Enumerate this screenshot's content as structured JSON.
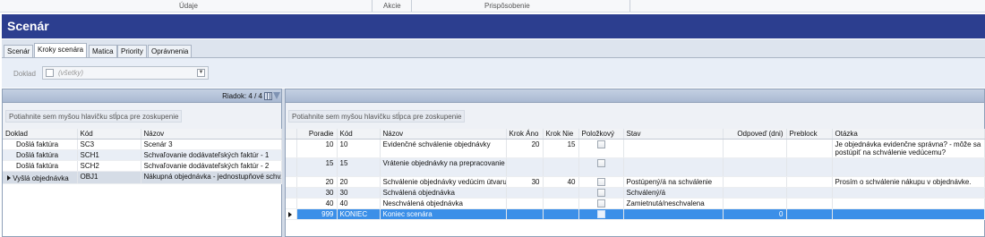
{
  "ribbon": {
    "groups": [
      "Údaje",
      "Akcie",
      "Prispôsobenie"
    ]
  },
  "window": {
    "title": "Scenár"
  },
  "tabs": [
    "Scenár",
    "Kroky scenára",
    "Matica",
    "Priority",
    "Oprávnenia"
  ],
  "active_tab": "Kroky scenára",
  "filter": {
    "label": "Doklad",
    "value": "(všetky)"
  },
  "left": {
    "rows_info": "Riadok: 4 / 4",
    "group_hint": "Potiahnite sem myšou hlavičku stĺpca pre zoskupenie",
    "columns": [
      "Doklad",
      "Kód",
      "Názov"
    ],
    "rows": [
      [
        "Došlá faktúra",
        "SC3",
        "Scenár 3"
      ],
      [
        "Došlá faktúra",
        "SCH1",
        "Schvaľovanie dodávateľských faktúr - 1"
      ],
      [
        "Došlá faktúra",
        "SCH2",
        "Schvaľovanie dodávateľských faktúr - 2"
      ],
      [
        "Vyšlá objednávka",
        "OBJ1",
        "Nákupná objednávka - jednostupňové schv."
      ]
    ]
  },
  "right": {
    "group_hint": "Potiahnite sem myšou hlavičku stĺpca pre zoskupenie",
    "columns": [
      "Poradie",
      "Kód",
      "Názov",
      "Krok Áno",
      "Krok Nie",
      "Položkový",
      "Stav",
      "Odpoveď (dni)",
      "Preblock",
      "Otázka"
    ],
    "rows": [
      [
        "10",
        "10",
        "Evidenčné schválenie objednávky",
        "20",
        "15",
        "",
        "",
        "",
        "",
        "Je objednávka evidenčne správna? - môže sa postúpiť na schválenie vedúcemu?"
      ],
      [
        "15",
        "15",
        "Vrátenie objednávky na prepracovanie",
        "",
        "",
        "",
        "",
        "",
        "",
        ""
      ],
      [
        "20",
        "20",
        "Schválenie objednávky vedúcim útvaru",
        "30",
        "40",
        "",
        "Postúpený/á na schválenie",
        "",
        "",
        "Prosím o schválenie nákupu v objednávke."
      ],
      [
        "30",
        "30",
        "Schválená objednávka",
        "",
        "",
        "",
        "Schválený/á",
        "",
        "",
        ""
      ],
      [
        "40",
        "40",
        "Neschválená objednávka",
        "",
        "",
        "",
        "Zamietnutá/neschvalena",
        "",
        "",
        ""
      ],
      [
        "999",
        "KONIEC",
        "Koniec scenára",
        "",
        "",
        "",
        "",
        "0",
        "",
        ""
      ]
    ]
  },
  "colors": {
    "title_bar": "#2c3e8f",
    "selected_row": "#3b8fe8",
    "alt_row": "#e9eef6"
  }
}
